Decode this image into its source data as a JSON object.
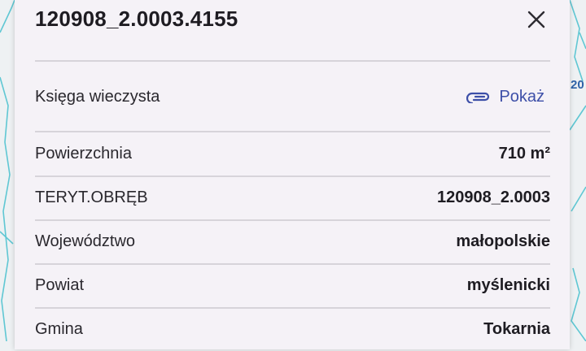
{
  "map": {
    "partial_label": "20"
  },
  "panel": {
    "title": "120908_2.0003.4155",
    "close_icon": "close-icon",
    "register": {
      "label": "Księga wieczysta",
      "link_label": "Pokaż",
      "link_icon": "paperclip-icon",
      "link_color": "#3d4fa8"
    },
    "rows": [
      {
        "label": "Powierzchnia",
        "value": "710 m²"
      },
      {
        "label": "TERYT.OBRĘB",
        "value": "120908_2.0003"
      },
      {
        "label": "Województwo",
        "value": "małopolskie"
      },
      {
        "label": "Powiat",
        "value": "myślenicki"
      },
      {
        "label": "Gmina",
        "value": "Tokarnia"
      }
    ]
  }
}
